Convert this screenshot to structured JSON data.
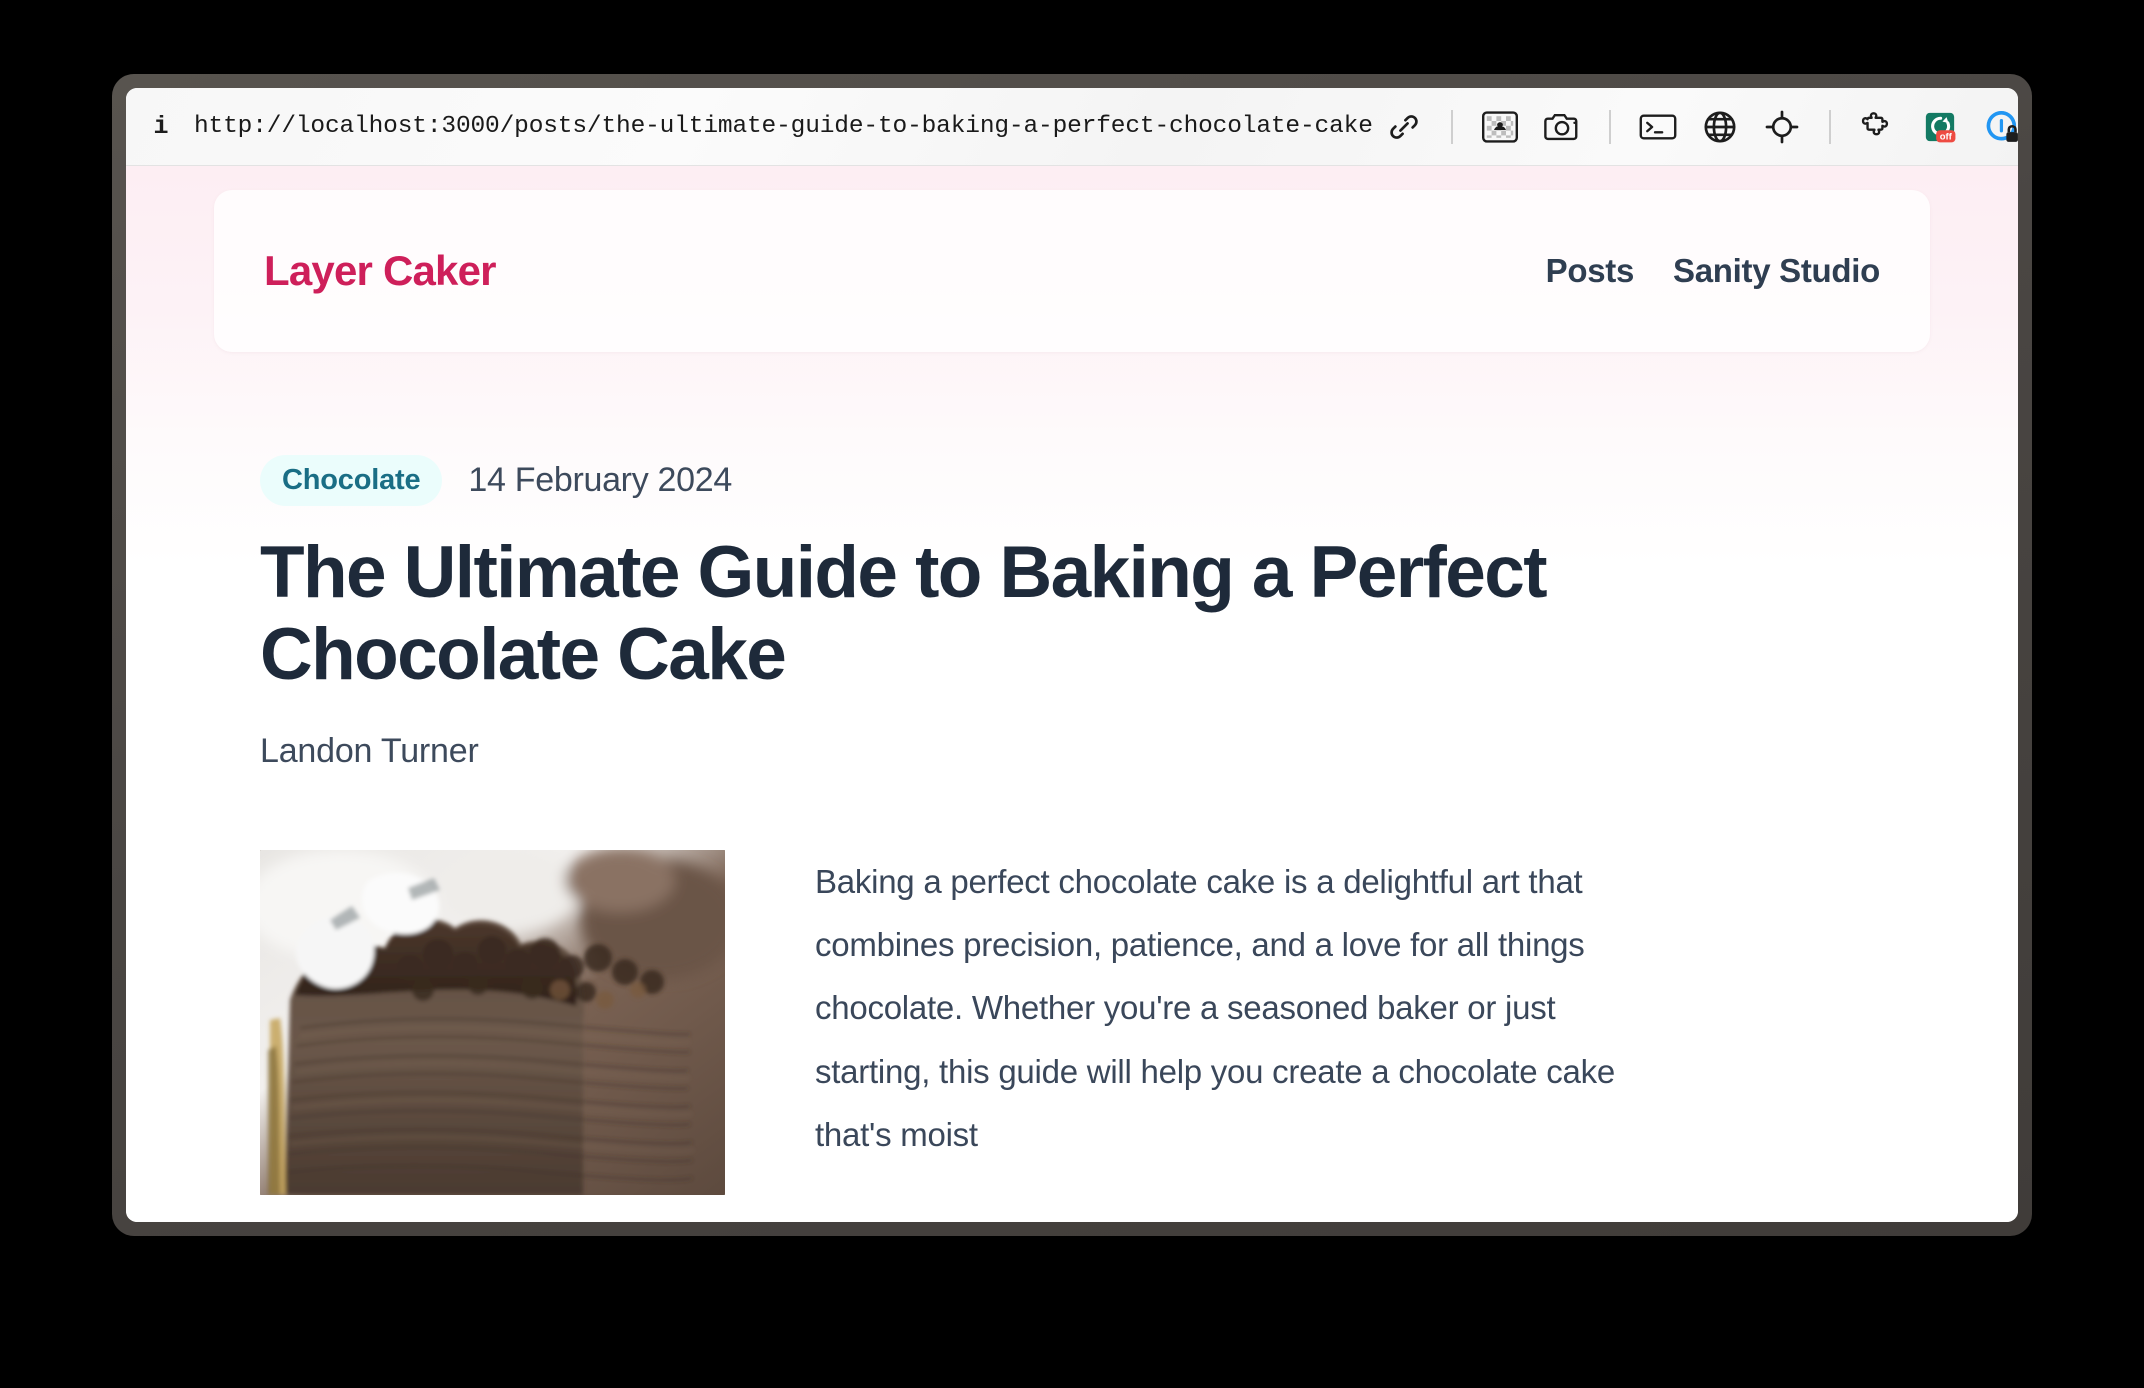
{
  "browser": {
    "url": "http://localhost:3000/posts/the-ultimate-guide-to-baking-a-perfect-chocolate-cake",
    "info_glyph": "i",
    "toolbar_icons": [
      "link-icon",
      "image-icon",
      "camera-icon",
      "terminal-icon",
      "globe-icon",
      "crosshair-icon",
      "puzzle-extension-icon",
      "adblock-off-icon",
      "privacy-lock-icon",
      "split-panel-icon"
    ],
    "adblock_badge_label": "off"
  },
  "site": {
    "brand": "Layer Caker",
    "nav": [
      {
        "label": "Posts",
        "name": "nav-link-posts"
      },
      {
        "label": "Sanity Studio",
        "name": "nav-link-sanity-studio"
      }
    ]
  },
  "post": {
    "category": "Chocolate",
    "date": "14 February 2024",
    "title": "The Ultimate Guide to Baking a Perfect Chocolate Cake",
    "author": "Landon Turner",
    "body": "Baking a perfect chocolate cake is a delightful art that combines precision, patience, and a love for all things chocolate. Whether you're a seasoned baker or just starting, this guide will help you create a chocolate cake that's moist",
    "image_alt": "slice-of-layered-chocolate-cake"
  },
  "colors": {
    "brand": "#ce1f5a",
    "nav_text": "#2f3e51",
    "badge_text": "#1a6e85",
    "badge_bg": "#ebfdfc",
    "title": "#1e2a3a",
    "body_text": "#3a475a",
    "page_gradient_top": "#fdeef3",
    "window_frame": "#4a4643"
  }
}
